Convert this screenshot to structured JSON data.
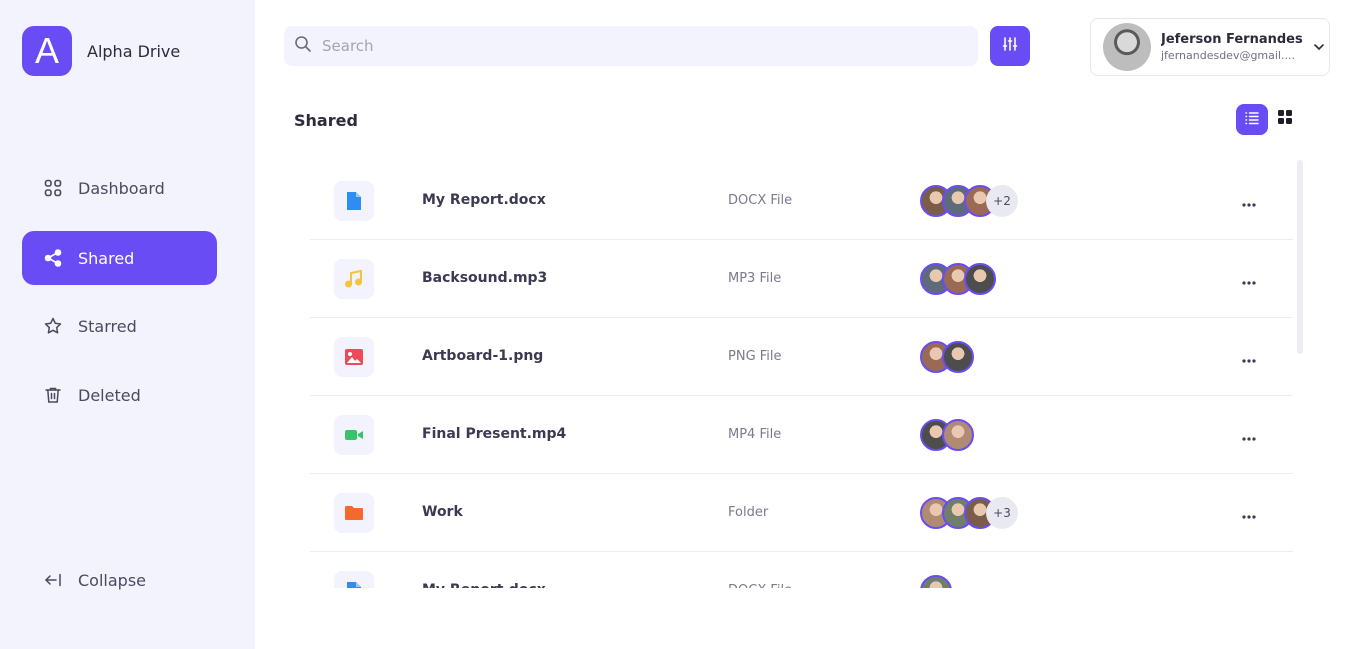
{
  "brand": {
    "logo_letter": "A",
    "name": "Alpha Drive",
    "color": "#6a4cf5"
  },
  "sidebar": {
    "items": [
      {
        "label": "Dashboard",
        "icon": "grid-icon"
      },
      {
        "label": "Shared",
        "icon": "share-icon",
        "active": true
      },
      {
        "label": "Starred",
        "icon": "star-icon"
      },
      {
        "label": "Deleted",
        "icon": "trash-icon"
      }
    ],
    "collapse_label": "Collapse"
  },
  "search": {
    "placeholder": "Search",
    "value": ""
  },
  "user": {
    "name": "Jeferson Fernandes",
    "email": "jfernandesdev@gmail...."
  },
  "main": {
    "title": "Shared"
  },
  "files": [
    {
      "name": "My Report.docx",
      "type": "DOCX File",
      "icon": "document-icon",
      "icon_color": "#2f8cf0",
      "avatars": 3,
      "extra": "+2"
    },
    {
      "name": "Backsound.mp3",
      "type": "MP3 File",
      "icon": "music-icon",
      "icon_color": "#f5c242",
      "avatars": 3,
      "extra": ""
    },
    {
      "name": "Artboard-1.png",
      "type": "PNG File",
      "icon": "image-icon",
      "icon_color": "#ef4a5a",
      "avatars": 2,
      "extra": ""
    },
    {
      "name": "Final Present.mp4",
      "type": "MP4 File",
      "icon": "video-icon",
      "icon_color": "#36c46a",
      "avatars": 2,
      "extra": ""
    },
    {
      "name": "Work",
      "type": "Folder",
      "icon": "folder-icon",
      "icon_color": "#f56a2b",
      "avatars": 3,
      "extra": "+3"
    },
    {
      "name": "My Report.docx",
      "type": "DOCX File",
      "icon": "document-icon",
      "icon_color": "#2f8cf0",
      "avatars": 1,
      "extra": ""
    }
  ]
}
